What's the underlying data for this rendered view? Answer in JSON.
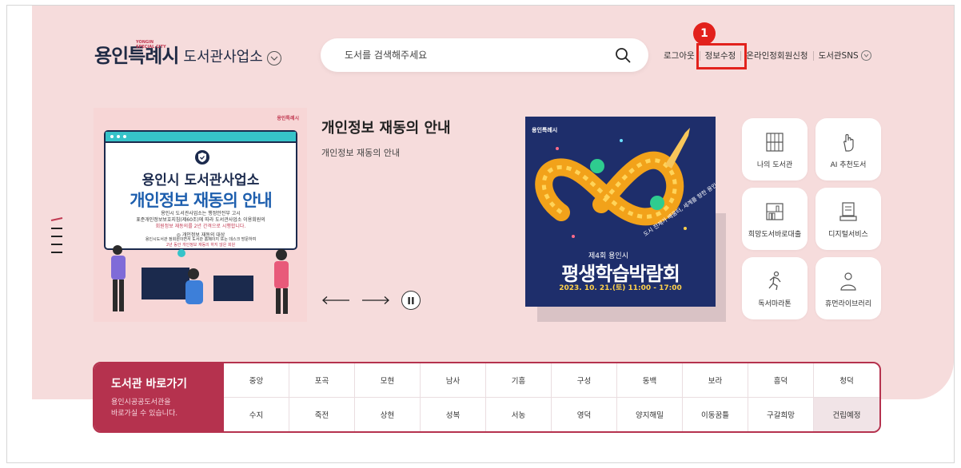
{
  "header": {
    "logo_main": "용인특례시",
    "logo_small": [
      "YONGIN",
      "SPECIAL CITY"
    ],
    "site_name": "도서관사업소",
    "search_placeholder": "도서를 검색해주세요",
    "links": [
      "로그아웃",
      "정보수정",
      "온라인정회원신청",
      "도서관SNS"
    ],
    "step_badge": "1"
  },
  "banner": {
    "logo": "용인특례시",
    "title1": "용인시 도서관사업소",
    "title2": "개인정보 재동의 안내",
    "lines": [
      "용인시 도서관사업소는 행정안전부 고시",
      "표준개인정보보호지침(제60조)에 따라 도서관사업소 이용회원의",
      "회원정보 재동의를 2년 간격으로 시행합니다.",
      "◎ 개인정보 재동의 대상",
      "용인시도서관 정회원이면서 도서관 홈페이지 또는 데스크 방문하여",
      "2년 동안 개인정보 재동의 하지 않은 회원"
    ]
  },
  "notice": {
    "title": "개인정보 재동의 안내",
    "desc": "개인정보 재동의 안내"
  },
  "poster": {
    "logo": "용인특례시",
    "line1": "제4회 용인시",
    "line2": "평생학습박람회",
    "line3": "2023. 10. 21.(토) 11:00 - 17:00",
    "ribbon": "도시 전체가 배움터, 세계를 향한 용인"
  },
  "quick": [
    {
      "label": "나의 도서관",
      "icon": "bookshelf-icon"
    },
    {
      "label": "AI 추천도서",
      "icon": "hand-pointer-icon"
    },
    {
      "label": "희망도서바로대출",
      "icon": "book-stack-icon"
    },
    {
      "label": "디지털서비스",
      "icon": "computer-icon"
    },
    {
      "label": "독서마라톤",
      "icon": "runner-icon"
    },
    {
      "label": "휴먼라이브러리",
      "icon": "person-icon"
    }
  ],
  "shortcut": {
    "title": "도서관 바로가기",
    "desc1": "용인시공공도서관을",
    "desc2": "바로가실 수 있습니다.",
    "libraries": [
      "중앙",
      "포곡",
      "모현",
      "남사",
      "기흥",
      "구성",
      "동백",
      "보라",
      "흥덕",
      "청덕",
      "수지",
      "죽전",
      "상현",
      "성복",
      "서농",
      "영덕",
      "양지해밀",
      "이동꿈틀",
      "구갈희망",
      "건립예정"
    ]
  },
  "colors": {
    "accent": "#b5324e",
    "background": "#f6dcdc",
    "highlight": "#e2211c",
    "poster": "#1e2e6b"
  }
}
